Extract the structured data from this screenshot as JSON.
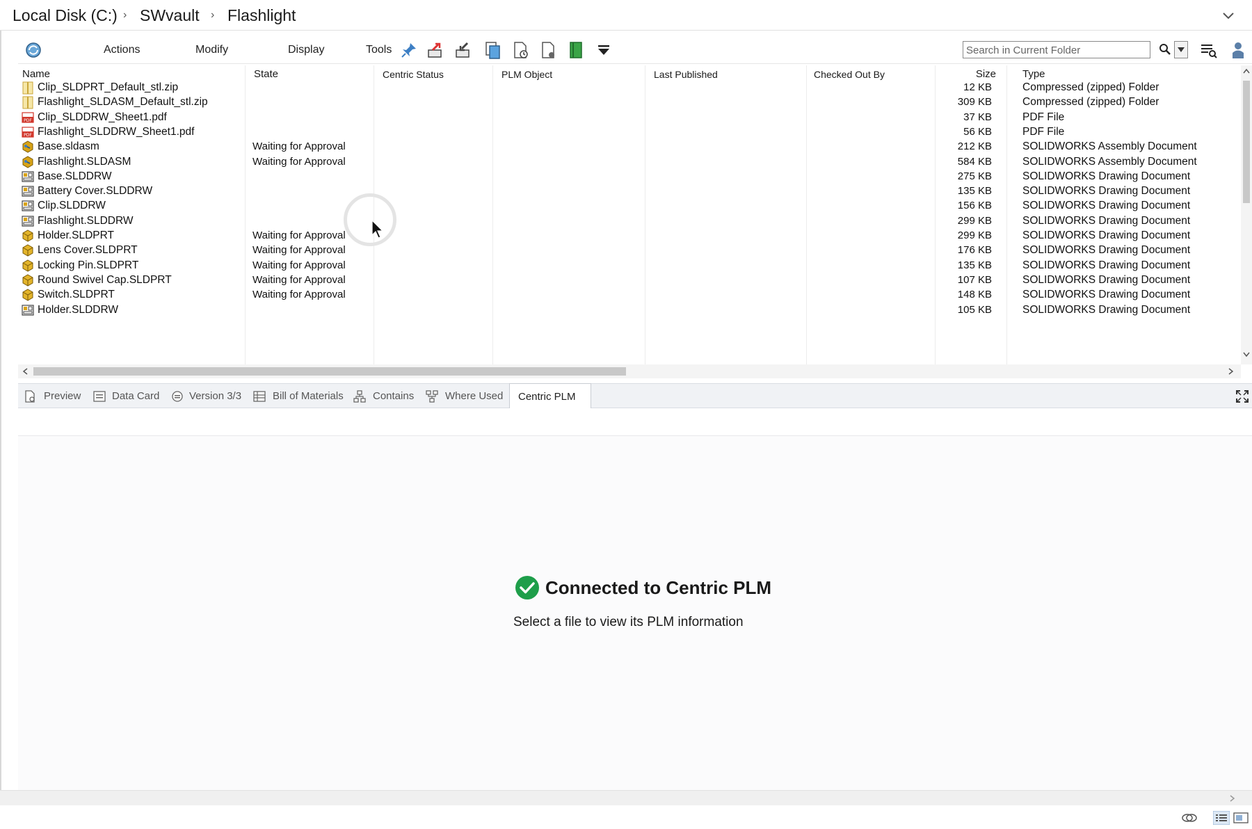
{
  "breadcrumb": {
    "items": [
      "Local Disk (C:)",
      "SWvault",
      "Flashlight"
    ]
  },
  "toolbar": {
    "menus": [
      "Actions",
      "Modify",
      "Display",
      "Tools"
    ],
    "search_placeholder": "Search in Current Folder",
    "icons": [
      "refresh-vault-icon",
      "pin-icon",
      "check-out-icon",
      "check-in-icon",
      "copy-files-icon",
      "get-version-icon",
      "document-properties-icon",
      "book-icon",
      "overflow-menu-icon",
      "search-icon",
      "search-dropdown-icon",
      "search-list-icon",
      "user-icon"
    ]
  },
  "columns": [
    "Name",
    "State",
    "Centric Status",
    "PLM Object",
    "Last Published",
    "Checked Out By",
    "Size",
    "Type"
  ],
  "files": [
    {
      "name": "Clip_SLDPRT_Default_stl.zip",
      "state": "",
      "size": "12 KB",
      "type": "Compressed (zipped) Folder",
      "icon": "zip-folder-icon"
    },
    {
      "name": "Flashlight_SLDASM_Default_stl.zip",
      "state": "",
      "size": "309 KB",
      "type": "Compressed (zipped) Folder",
      "icon": "zip-folder-icon"
    },
    {
      "name": "Clip_SLDDRW_Sheet1.pdf",
      "state": "",
      "size": "37 KB",
      "type": "PDF File",
      "icon": "pdf-icon"
    },
    {
      "name": "Flashlight_SLDDRW_Sheet1.pdf",
      "state": "",
      "size": "56 KB",
      "type": "PDF File",
      "icon": "pdf-icon"
    },
    {
      "name": "Base.sldasm",
      "state": "Waiting for Approval",
      "size": "212 KB",
      "type": "SOLIDWORKS Assembly Document",
      "icon": "assembly-icon"
    },
    {
      "name": "Flashlight.SLDASM",
      "state": "Waiting for Approval",
      "size": "584 KB",
      "type": "SOLIDWORKS Assembly Document",
      "icon": "assembly-icon"
    },
    {
      "name": "Base.SLDDRW",
      "state": "",
      "size": "275 KB",
      "type": "SOLIDWORKS Drawing Document",
      "icon": "drawing-icon"
    },
    {
      "name": "Battery Cover.SLDDRW",
      "state": "",
      "size": "135 KB",
      "type": "SOLIDWORKS Drawing Document",
      "icon": "drawing-icon"
    },
    {
      "name": "Clip.SLDDRW",
      "state": "",
      "size": "156 KB",
      "type": "SOLIDWORKS Drawing Document",
      "icon": "drawing-icon"
    },
    {
      "name": "Flashlight.SLDDRW",
      "state": "",
      "size": "299 KB",
      "type": "SOLIDWORKS Drawing Document",
      "icon": "drawing-icon"
    },
    {
      "name": "Holder.SLDPRT",
      "state": "Waiting for Approval",
      "size": "299 KB",
      "type": "SOLIDWORKS Drawing Document",
      "icon": "part-icon"
    },
    {
      "name": "Lens Cover.SLDPRT",
      "state": "Waiting for Approval",
      "size": "176 KB",
      "type": "SOLIDWORKS Drawing Document",
      "icon": "part-icon"
    },
    {
      "name": "Locking Pin.SLDPRT",
      "state": "Waiting for Approval",
      "size": "135 KB",
      "type": "SOLIDWORKS Drawing Document",
      "icon": "part-icon"
    },
    {
      "name": "Round Swivel Cap.SLDPRT",
      "state": "Waiting for Approval",
      "size": "107 KB",
      "type": "SOLIDWORKS Drawing Document",
      "icon": "part-icon"
    },
    {
      "name": "Switch.SLDPRT",
      "state": "Waiting for Approval",
      "size": "148 KB",
      "type": "SOLIDWORKS Drawing Document",
      "icon": "part-icon"
    },
    {
      "name": "Holder.SLDDRW",
      "state": "",
      "size": "105 KB",
      "type": "SOLIDWORKS Drawing Document",
      "icon": "drawing-icon"
    }
  ],
  "tabs": [
    {
      "label": "Preview",
      "icon": "preview-icon"
    },
    {
      "label": "Data Card",
      "icon": "data-card-icon"
    },
    {
      "label": "Version 3/3",
      "icon": "version-icon"
    },
    {
      "label": "Bill of Materials",
      "icon": "bill-of-materials-icon"
    },
    {
      "label": "Contains",
      "icon": "contains-icon"
    },
    {
      "label": "Where Used",
      "icon": "where-used-icon"
    },
    {
      "label": "Centric PLM",
      "icon": ""
    }
  ],
  "active_tab": "Centric PLM",
  "plm": {
    "title": "Connected to Centric PLM",
    "subtitle": "Select a file to view its PLM information",
    "status_color": "#1e9e4a"
  },
  "colors": {
    "accent": "#2b6cb0",
    "part_icon": "#d8a317",
    "pdf_icon": "#d1372c"
  }
}
